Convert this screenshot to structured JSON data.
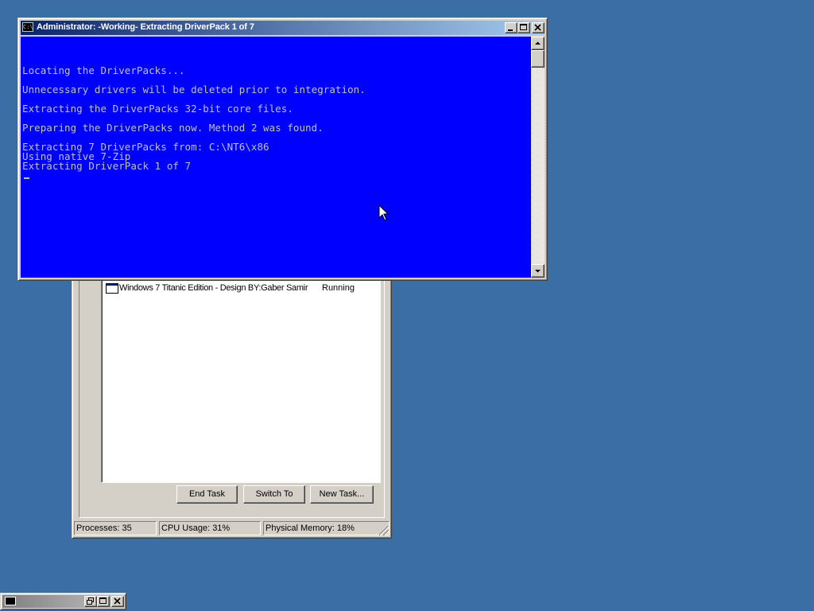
{
  "console": {
    "title": "Administrator:  -Working- Extracting DriverPack 1 of 7",
    "icon": "cmd-icon",
    "buttons": {
      "minimize": "0",
      "maximize": "1",
      "close": "r"
    },
    "lines": [
      "Locating the DriverPacks...",
      "Unnecessary drivers will be deleted prior to integration.",
      "Extracting the DriverPacks 32-bit core files.",
      "Preparing the DriverPacks now. Method 2 was found.",
      "Extracting 7 DriverPacks from: C:\\NT6\\x86",
      "Using native 7-Zip",
      "Extracting DriverPack 1 of 7"
    ],
    "colors": {
      "background": "#0000ff",
      "text": "#c0c0c0"
    }
  },
  "task_manager": {
    "tasks": [
      {
        "name": "Windows 7 Titanic Edition - Design BY:Gaber Samir",
        "status": "Running"
      }
    ],
    "buttons": {
      "end_task": "End Task",
      "switch_to": "Switch To",
      "new_task": "New Task..."
    },
    "status_bar": {
      "processes": "Processes: 35",
      "cpu": "CPU Usage: 31%",
      "memory": "Physical Memory: 18%"
    }
  },
  "desktop": {
    "background": "#3a6ea5"
  }
}
